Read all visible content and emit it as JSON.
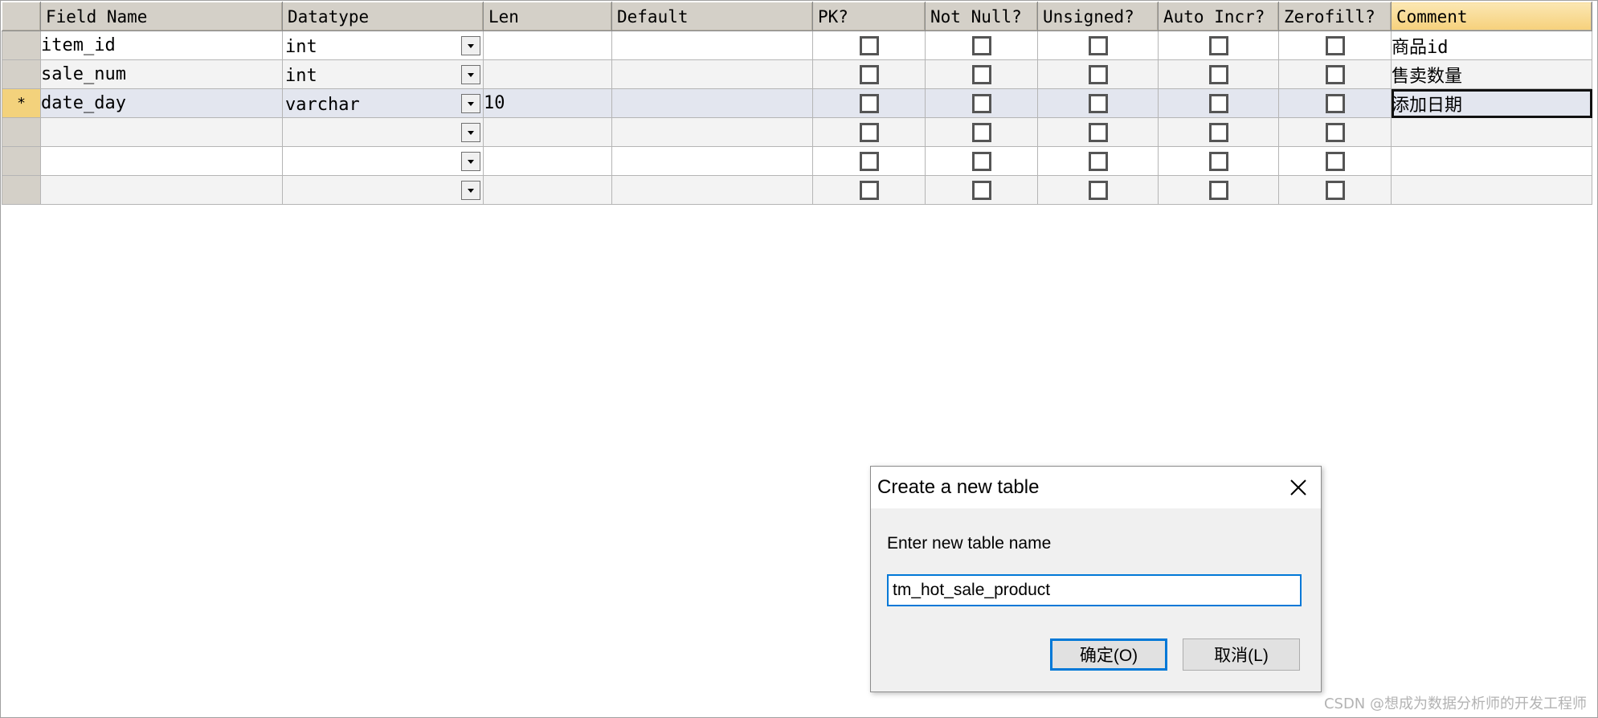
{
  "grid": {
    "columns": [
      "Field Name",
      "Datatype",
      "Len",
      "Default",
      "PK?",
      "Not Null?",
      "Unsigned?",
      "Auto Incr?",
      "Zerofill?",
      "Comment"
    ],
    "current_row_marker": "*",
    "rows": [
      {
        "field_name": "item_id",
        "datatype": "int",
        "len": "",
        "default": "",
        "comment": "商品id"
      },
      {
        "field_name": "sale_num",
        "datatype": "int",
        "len": "",
        "default": "",
        "comment": "售卖数量"
      },
      {
        "field_name": "date_day",
        "datatype": "varchar",
        "len": "10",
        "default": "",
        "comment": "添加日期"
      },
      {
        "field_name": "",
        "datatype": "",
        "len": "",
        "default": "",
        "comment": ""
      },
      {
        "field_name": "",
        "datatype": "",
        "len": "",
        "default": "",
        "comment": ""
      },
      {
        "field_name": "",
        "datatype": "",
        "len": "",
        "default": "",
        "comment": ""
      }
    ]
  },
  "dialog": {
    "title": "Create a new table",
    "prompt": "Enter new table name",
    "table_name_value": "tm_hot_sale_product",
    "ok_label": "确定(O)",
    "cancel_label": "取消(L)"
  },
  "watermark": "CSDN @想成为数据分析师的开发工程师"
}
